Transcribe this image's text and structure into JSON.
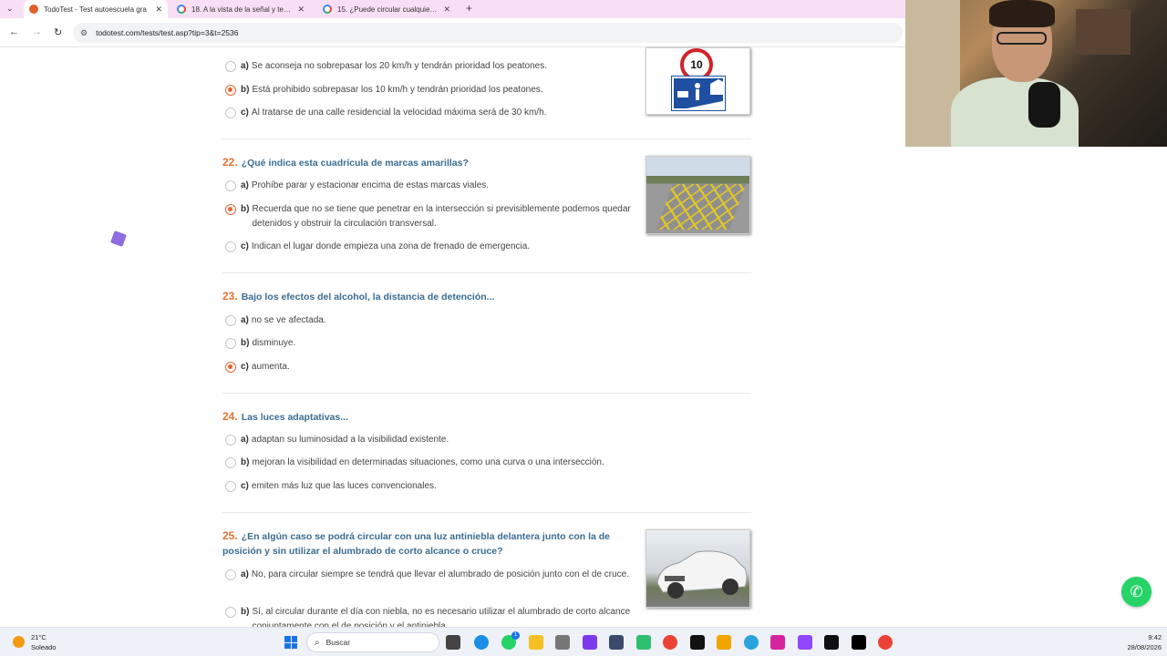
{
  "browser": {
    "tabs": [
      {
        "title": "TodoTest - Test autoescuela gra",
        "active": true
      },
      {
        "title": "18. A la vista de la señal y tenie",
        "active": false
      },
      {
        "title": "15. ¿Puede circular cualquier ve",
        "active": false
      }
    ],
    "url": "todotest.com/tests/test.asp?tip=3&t=2536"
  },
  "questions": [
    {
      "number": "",
      "text": "",
      "options": [
        {
          "letter": "a)",
          "text": "Se aconseja no sobrepasar los 20 km/h y tendrán prioridad los peatones.",
          "selected": false
        },
        {
          "letter": "b)",
          "text": "Está prohibido sobrepasar los 10 km/h y tendrán prioridad los peatones.",
          "selected": true
        },
        {
          "letter": "c)",
          "text": "Al tratarse de una calle residencial la velocidad máxima será de 30 km/h.",
          "selected": false
        }
      ],
      "sign_value": "10"
    },
    {
      "number": "22.",
      "text": "¿Qué indica esta cuadrícula de marcas amarillas?",
      "options": [
        {
          "letter": "a)",
          "text": "Prohíbe parar y estacionar encima de estas marcas viales.",
          "selected": false
        },
        {
          "letter": "b)",
          "text": "Recuerda que no se tiene que penetrar en la intersección si previsiblemente podemos quedar detenidos y obstruir la circulación transversal.",
          "selected": true
        },
        {
          "letter": "c)",
          "text": "Indican el lugar donde empieza una zona de frenado de emergencia.",
          "selected": false
        }
      ]
    },
    {
      "number": "23.",
      "text": "Bajo los efectos del alcohol, la distancia de detención...",
      "options": [
        {
          "letter": "a)",
          "text": "no se ve afectada.",
          "selected": false
        },
        {
          "letter": "b)",
          "text": "disminuye.",
          "selected": false
        },
        {
          "letter": "c)",
          "text": "aumenta.",
          "selected": true
        }
      ]
    },
    {
      "number": "24.",
      "text": "Las luces adaptativas...",
      "options": [
        {
          "letter": "a)",
          "text": "adaptan su luminosidad a la visibilidad existente.",
          "selected": false
        },
        {
          "letter": "b)",
          "text": "mejoran la visibilidad en determinadas situaciones, como una curva o una intersección.",
          "selected": false
        },
        {
          "letter": "c)",
          "text": "emiten más luz que las luces convencionales.",
          "selected": false
        }
      ]
    },
    {
      "number": "25.",
      "text": "¿En algún caso se podrá circular con una luz antiniebla delantera junto con la de posición y sin utilizar el alumbrado de corto alcance o cruce?",
      "options": [
        {
          "letter": "a)",
          "text": "No, para circular siempre se tendrá que llevar el alumbrado de posición junto con el de cruce.",
          "selected": false
        },
        {
          "letter": "b)",
          "text": "Sí, al circular durante el día con niebla, no es necesario utilizar el alumbrado de corto alcance conjuntamente con el de posición y el antiniebla.",
          "selected": false
        }
      ]
    }
  ],
  "taskbar": {
    "temperature": "21°C",
    "weather": "Soleado",
    "search_placeholder": "Buscar",
    "time": "9:42",
    "date": "28/08/2026",
    "badge": "1"
  }
}
